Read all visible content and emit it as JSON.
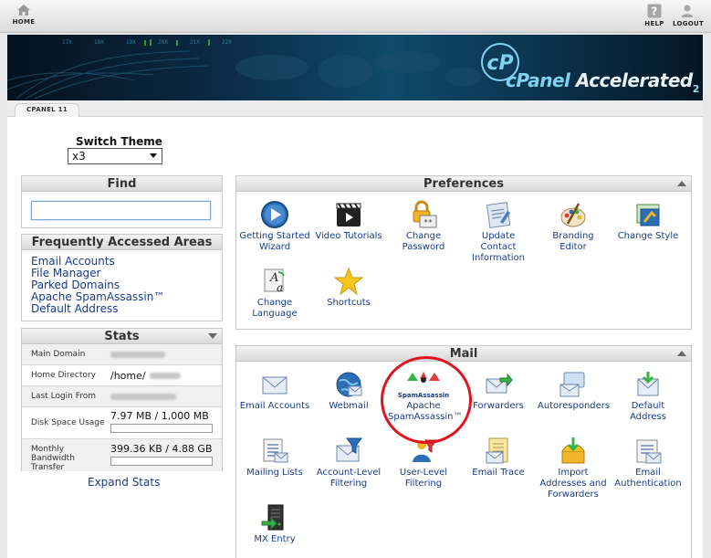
{
  "topbar": {
    "home": "HOME",
    "help": "HELP",
    "logout": "LOGOUT"
  },
  "banner": {
    "brand_c": "cPanel",
    "brand_accel": "Accelerated",
    "brand_version": "2"
  },
  "tab": "CPANEL 11",
  "theme": {
    "label": "Switch Theme",
    "value": "x3"
  },
  "find": {
    "title": "Find",
    "value": ""
  },
  "faa": {
    "title": "Frequently Accessed Areas",
    "links": [
      "Email Accounts",
      "File Manager",
      "Parked Domains",
      "Apache SpamAssassin™",
      "Default Address"
    ]
  },
  "stats": {
    "title": "Stats",
    "rows": [
      {
        "label": "Main Domain",
        "value": ""
      },
      {
        "label": "Home Directory",
        "value": "/home/"
      },
      {
        "label": "Last Login From",
        "value": ""
      },
      {
        "label": "Disk Space Usage",
        "value": "7.97 MB / 1,000 MB",
        "fraction": 0.008
      },
      {
        "label": "Monthly Bandwidth Transfer",
        "value": "399.36 KB / 4.88 GB",
        "fraction": 0.0001
      }
    ],
    "expand": "Expand Stats"
  },
  "preferences": {
    "title": "Preferences",
    "items": [
      {
        "label": "Getting Started Wizard",
        "icon": "play-icon"
      },
      {
        "label": "Video Tutorials",
        "icon": "film-icon"
      },
      {
        "label": "Change Password",
        "icon": "lock-icon"
      },
      {
        "label": "Update Contact Information",
        "icon": "contact-icon"
      },
      {
        "label": "Branding Editor",
        "icon": "palette-icon"
      },
      {
        "label": "Change Style",
        "icon": "style-icon"
      },
      {
        "label": "Change Language",
        "icon": "language-icon"
      },
      {
        "label": "Shortcuts",
        "icon": "star-icon"
      }
    ]
  },
  "mail": {
    "title": "Mail",
    "items": [
      {
        "label": "Email Accounts",
        "icon": "envelope-icon"
      },
      {
        "label": "Webmail",
        "icon": "globe-icon"
      },
      {
        "label": "Apache SpamAssassin™",
        "icon": "spamassassin-icon"
      },
      {
        "label": "Forwarders",
        "icon": "forward-icon"
      },
      {
        "label": "Autoresponders",
        "icon": "autoresponder-icon"
      },
      {
        "label": "Default Address",
        "icon": "default-address-icon"
      },
      {
        "label": "Mailing Lists",
        "icon": "list-icon"
      },
      {
        "label": "Account-Level Filtering",
        "icon": "filter-icon"
      },
      {
        "label": "User-Level Filtering",
        "icon": "user-filter-icon"
      },
      {
        "label": "Email Trace",
        "icon": "trace-icon"
      },
      {
        "label": "Import Addresses and Forwarders",
        "icon": "import-icon"
      },
      {
        "label": "Email Authentication",
        "icon": "auth-icon"
      },
      {
        "label": "MX Entry",
        "icon": "server-icon"
      }
    ],
    "spamassassin_logo_text": "SpamAssassin"
  },
  "colors": {
    "link": "#1a3a8a",
    "highlight": "#e0141e",
    "accent_blue": "#2d6fb7"
  }
}
